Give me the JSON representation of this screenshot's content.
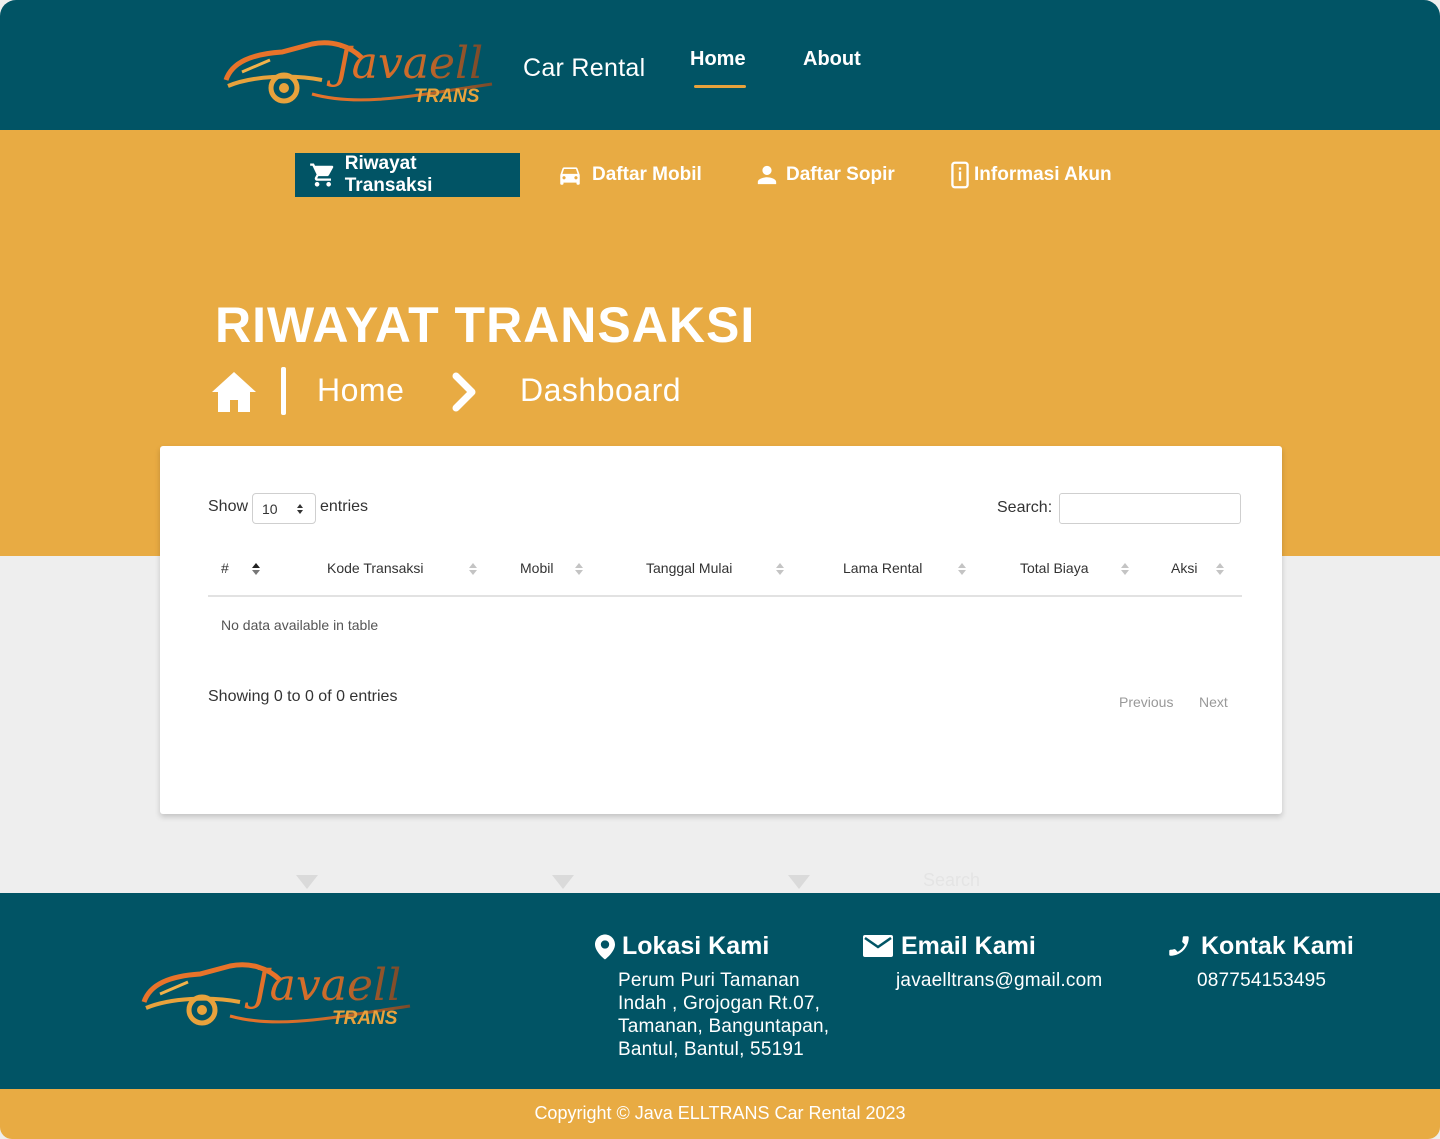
{
  "header": {
    "logo_script": "Javaell",
    "logo_sub": "TRANS",
    "brand_sub": "Car Rental",
    "nav": [
      {
        "label": "Home",
        "active": true
      },
      {
        "label": "About",
        "active": false
      }
    ]
  },
  "subnav": [
    {
      "label": "Riwayat Transaksi",
      "icon": "cart-icon",
      "active": true
    },
    {
      "label": "Daftar Mobil",
      "icon": "car-icon",
      "active": false
    },
    {
      "label": "Daftar Sopir",
      "icon": "person-icon",
      "active": false
    },
    {
      "label": "Informasi Akun",
      "icon": "phone-info-icon",
      "active": false
    }
  ],
  "page": {
    "title": "RIWAYAT TRANSAKSI",
    "breadcrumb": [
      "Home",
      "Dashboard"
    ]
  },
  "table": {
    "show_label": "Show",
    "entries_value": "10",
    "entries_label": "entries",
    "search_label": "Search:",
    "search_value": "",
    "columns": [
      "#",
      "Kode Transaksi",
      "Mobil",
      "Tanggal Mulai",
      "Lama Rental",
      "Total Biaya",
      "Aksi"
    ],
    "empty_text": "No data available in table",
    "info": "Showing 0 to 0 of 0 entries",
    "previous": "Previous",
    "next": "Next"
  },
  "ghost_text": "Search",
  "footer": {
    "location_title": "Lokasi Kami",
    "location_lines": [
      "Perum Puri Tamanan",
      "Indah , Grojogan Rt.07,",
      "Tamanan, Banguntapan,",
      "Bantul, Bantul, 55191"
    ],
    "email_title": "Email Kami",
    "email": "javaelltrans@gmail.com",
    "contact_title": "Kontak Kami",
    "phone": "087754153495",
    "copyright": "Copyright © Java ELLTRANS Car Rental 2023"
  },
  "colors": {
    "primary": "#015465",
    "accent": "#e8ab43",
    "logo_orange": "#e8732a",
    "background": "#eeeeee"
  }
}
